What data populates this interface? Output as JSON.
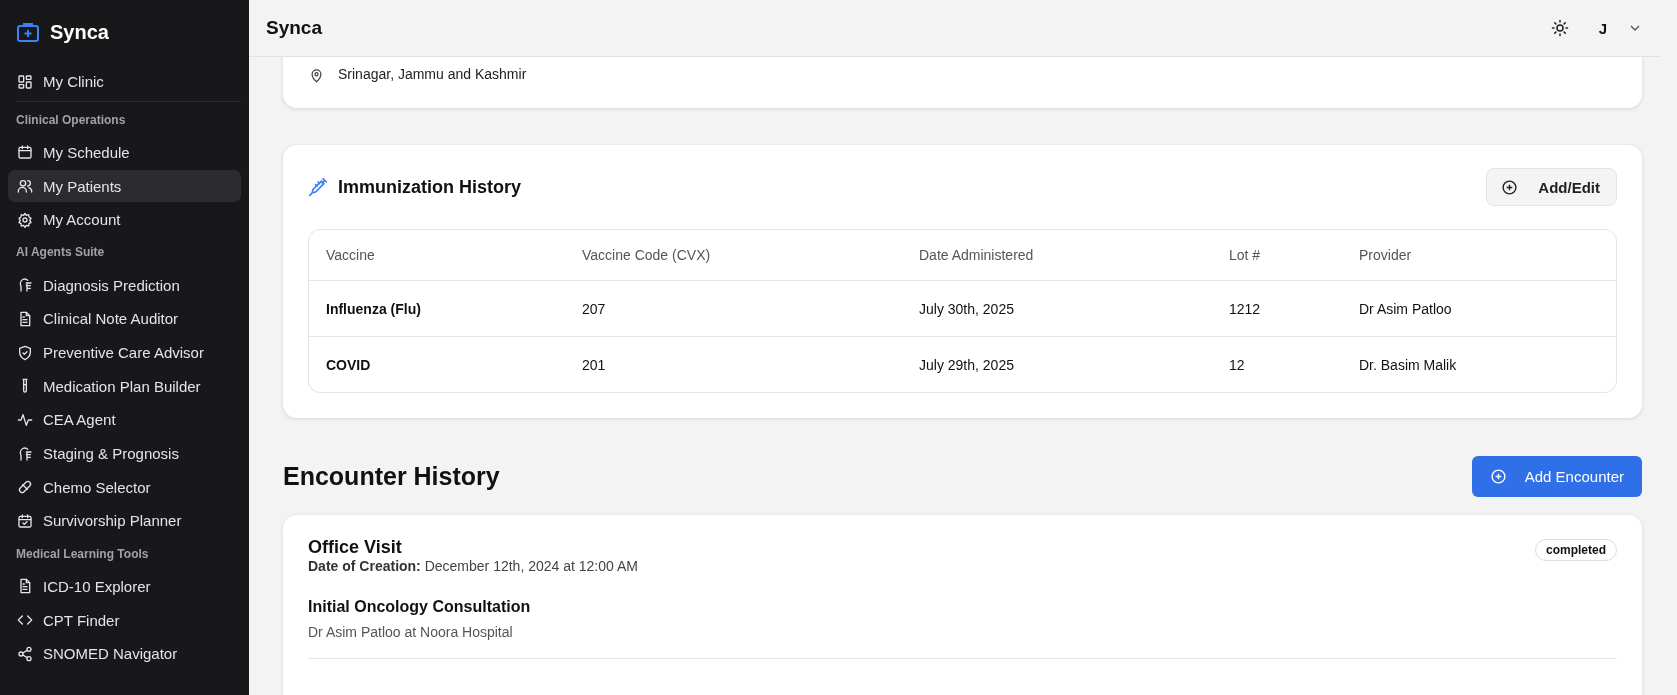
{
  "sidebar": {
    "brand": "Synca",
    "items": [
      {
        "kind": "item",
        "label": "My Clinic",
        "selected": false
      },
      {
        "kind": "section",
        "label": "Clinical Operations"
      },
      {
        "kind": "item",
        "label": "My Schedule",
        "selected": false
      },
      {
        "kind": "item",
        "label": "My Patients",
        "selected": true
      },
      {
        "kind": "item",
        "label": "My Account",
        "selected": false
      },
      {
        "kind": "section",
        "label": "AI Agents Suite"
      },
      {
        "kind": "item",
        "label": "Diagnosis Prediction",
        "selected": false
      },
      {
        "kind": "item",
        "label": "Clinical Note Auditor",
        "selected": false
      },
      {
        "kind": "item",
        "label": "Preventive Care Advisor",
        "selected": false
      },
      {
        "kind": "item",
        "label": "Medication Plan Builder",
        "selected": false
      },
      {
        "kind": "item",
        "label": "CEA Agent",
        "selected": false
      },
      {
        "kind": "item",
        "label": "Staging & Prognosis",
        "selected": false
      },
      {
        "kind": "item",
        "label": "Chemo Selector",
        "selected": false
      },
      {
        "kind": "item",
        "label": "Survivorship Planner",
        "selected": false
      },
      {
        "kind": "section",
        "label": "Medical Learning Tools"
      },
      {
        "kind": "item",
        "label": "ICD-10 Explorer",
        "selected": false
      },
      {
        "kind": "item",
        "label": "CPT Finder",
        "selected": false
      },
      {
        "kind": "item",
        "label": "SNOMED Navigator",
        "selected": false
      }
    ]
  },
  "header": {
    "title": "Synca",
    "user_initial": "J"
  },
  "location": "Srinagar, Jammu and Kashmir",
  "immunization": {
    "title": "Immunization History",
    "button": "Add/Edit",
    "table": {
      "columns": [
        "Vaccine",
        "Vaccine Code (CVX)",
        "Date Administered",
        "Lot #",
        "Provider"
      ],
      "rows": [
        [
          "Influenza (Flu)",
          "207",
          "July 30th, 2025",
          "1212",
          "Dr Asim Patloo"
        ],
        [
          "COVID",
          "201",
          "July 29th, 2025",
          "12",
          "Dr. Basim Malik"
        ]
      ]
    }
  },
  "encounters": {
    "title": "Encounter History",
    "button": "Add Encounter",
    "items": [
      {
        "type": "Office Visit",
        "date_label": "Date of Creation:",
        "date": "December 12th, 2024 at 12:00 AM",
        "status": "completed",
        "reason": "Initial Oncology Consultation",
        "provider": "Dr Asim Patloo at Noora Hospital"
      }
    ]
  }
}
